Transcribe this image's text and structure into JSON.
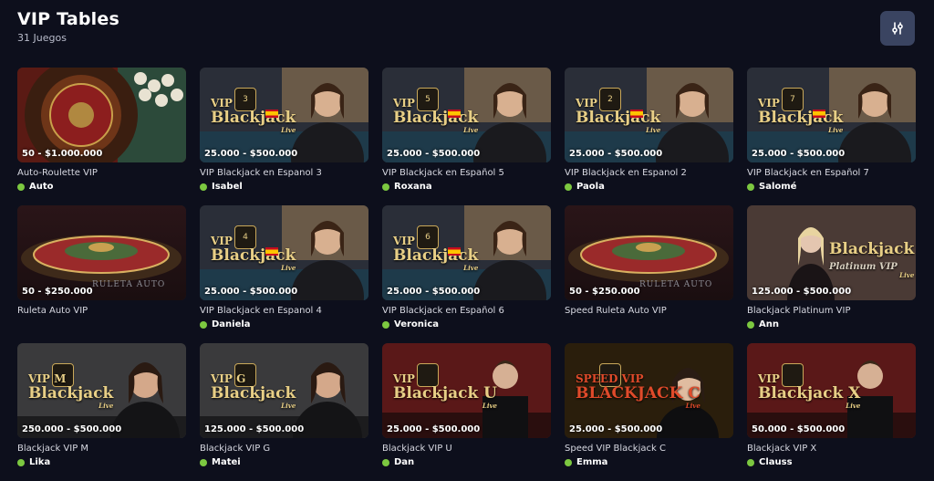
{
  "header": {
    "title": "VIP Tables",
    "subtitle": "31 Juegos",
    "filter_icon": "sliders-icon"
  },
  "colors": {
    "background": "#0d0f1c",
    "online_dot": "#7cc840",
    "filter_button": "#3a4461"
  },
  "games": [
    {
      "price": "50 - $1.000.000",
      "name": "Auto-Roulette VIP",
      "dealer": "Auto",
      "kind": "roulette-top"
    },
    {
      "price": "25.000 - $500.000",
      "name": "VIP Blackjack en Espanol 3",
      "dealer": "Isabel",
      "kind": "bj",
      "logo_vip": "VIP",
      "logo_bj": "Blackjack",
      "logo_live": "Live",
      "hex": "3"
    },
    {
      "price": "25.000 - $500.000",
      "name": "VIP Blackjack en Español 5",
      "dealer": "Roxana",
      "kind": "bj",
      "logo_vip": "VIP",
      "logo_bj": "Blackjack",
      "logo_live": "Live",
      "hex": "5"
    },
    {
      "price": "25.000 - $500.000",
      "name": "VIP Blackjack en Espanol 2",
      "dealer": "Paola",
      "kind": "bj",
      "logo_vip": "VIP",
      "logo_bj": "Blackjack",
      "logo_live": "Live",
      "hex": "2"
    },
    {
      "price": "25.000 - $500.000",
      "name": "VIP Blackjack en Español 7",
      "dealer": "Salomé",
      "kind": "bj",
      "logo_vip": "VIP",
      "logo_bj": "Blackjack",
      "logo_live": "Live",
      "hex": "7"
    },
    {
      "price": "50 - $250.000",
      "name": "Ruleta Auto VIP",
      "dealer": "",
      "kind": "roulette-side",
      "overlay": "RULETA AUTO"
    },
    {
      "price": "25.000 - $500.000",
      "name": "VIP Blackjack en Espanol 4",
      "dealer": "Daniela",
      "kind": "bj",
      "logo_vip": "VIP",
      "logo_bj": "Blackjack",
      "logo_live": "Live",
      "hex": "4"
    },
    {
      "price": "25.000 - $500.000",
      "name": "VIP Blackjack en Español 6",
      "dealer": "Veronica",
      "kind": "bj",
      "logo_vip": "VIP",
      "logo_bj": "Blackjack",
      "logo_live": "Live",
      "hex": "6"
    },
    {
      "price": "50 - $250.000",
      "name": "Speed Ruleta Auto VIP",
      "dealer": "",
      "kind": "roulette-side",
      "overlay": "RULETA AUTO"
    },
    {
      "price": "125.000 - $500.000",
      "name": "Blackjack Platinum VIP",
      "dealer": "Ann",
      "kind": "platinum",
      "logo_bj": "Blackjack",
      "logo_live": "Live",
      "logo_sub": "Platinum VIP"
    },
    {
      "price": "250.000 - $500.000",
      "name": "Blackjack VIP M",
      "dealer": "Lika",
      "kind": "bjgray",
      "logo_vip": "VIP M",
      "logo_bj": "Blackjack",
      "logo_live": "Live"
    },
    {
      "price": "125.000 - $500.000",
      "name": "Blackjack VIP G",
      "dealer": "Matei",
      "kind": "bjgray",
      "logo_vip": "VIP G",
      "logo_bj": "Blackjack",
      "logo_live": "Live"
    },
    {
      "price": "25.000 - $500.000",
      "name": "Blackjack VIP U",
      "dealer": "Dan",
      "kind": "bjred",
      "logo_vip": "VIP",
      "logo_bj": "Blackjack U",
      "logo_live": "Live"
    },
    {
      "price": "25.000 - $500.000",
      "name": "Speed VIP Blackjack C",
      "dealer": "Emma",
      "kind": "speed",
      "logo_vip": "SPEED VIP",
      "logo_bj": "BLACKJACK C",
      "logo_live": "Live"
    },
    {
      "price": "50.000 - $500.000",
      "name": "Blackjack VIP X",
      "dealer": "Clauss",
      "kind": "bjred",
      "logo_vip": "VIP",
      "logo_bj": "Blackjack X",
      "logo_live": "Live"
    }
  ]
}
